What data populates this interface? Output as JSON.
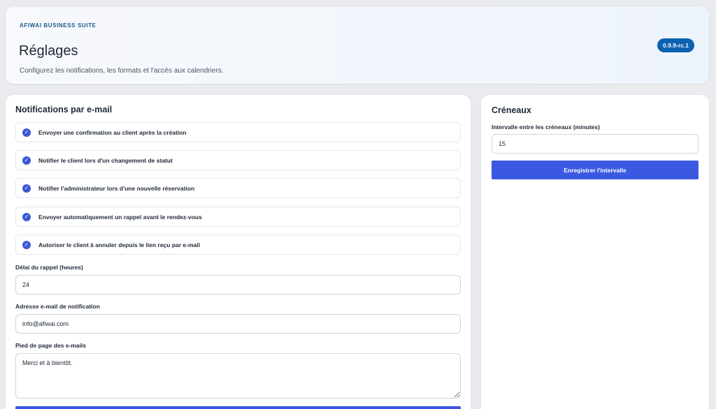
{
  "header": {
    "brand": "AFIWAI BUSINESS SUITE",
    "title": "Réglages",
    "subtitle": "Configurez les notifications, les formats et l'accès aux calendriers.",
    "version": "0.9.9-rc.1"
  },
  "notifications": {
    "title": "Notifications par e-mail",
    "options": [
      {
        "label": "Envoyer une confirmation au client après la création",
        "checked": true,
        "icon": "check-circle-icon"
      },
      {
        "label": "Notifier le client lors d'un changement de statut",
        "checked": true,
        "icon": "check-circle-icon"
      },
      {
        "label": "Notifier l'administrateur lors d'une nouvelle réservation",
        "checked": true,
        "icon": "check-circle-icon"
      },
      {
        "label": "Envoyer automatiquement un rappel avant le rendez-vous",
        "checked": true,
        "icon": "check-circle-icon"
      },
      {
        "label": "Autoriser le client à annuler depuis le lien reçu par e-mail",
        "checked": true,
        "icon": "check-circle-icon"
      }
    ],
    "reminder": {
      "label": "Délai du rappel (heures)",
      "value": "24"
    },
    "email": {
      "label": "Adresse e-mail de notification",
      "value": "info@afiwai.com"
    },
    "footer": {
      "label": "Pied de page des e-mails",
      "value": "Merci et à bientôt."
    }
  },
  "slots": {
    "title": "Créneaux",
    "interval": {
      "label": "Intervalle entre les créneaux (minutes)",
      "value": "15"
    },
    "save_label": "Enregistrer l'intervalle"
  },
  "colors": {
    "accent": "#3b59e0",
    "badge": "#0b62b0",
    "brand": "#1a5a8a"
  }
}
